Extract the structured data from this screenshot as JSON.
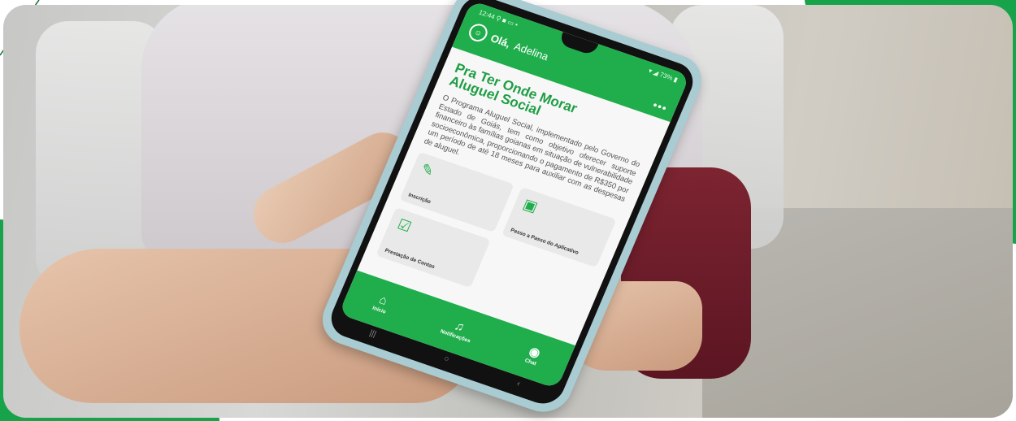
{
  "phone": {
    "status_left": "12:44 ⚲ ■ ▭ •",
    "status_right": "▾ ◢ 73% ▮",
    "greeting_bold": "Olá,",
    "greeting_name": "Adelina",
    "menu": "•••",
    "title_line1": "Pra Ter Onde Morar",
    "title_line2": "Aluguel Social",
    "description": "O Programa Aluguel Social, implementado pelo Governo do Estado de Goiás, tem como objetivo oferecer suporte financeiro às famílias goianas em situação de vulnerabilidade socioeconômica, proporcionando o pagamento de R$350 por um período de até 18 meses para auxiliar com as despesas de aluguel.",
    "cards": [
      {
        "label": "Inscrição",
        "icon": "edit-icon"
      },
      {
        "label": "Passo a Passo do Aplicativo",
        "icon": "phone-guide-icon"
      },
      {
        "label": "Prestação de Contas",
        "icon": "document-check-icon"
      }
    ],
    "nav": [
      {
        "label": "Início",
        "icon": "home-icon"
      },
      {
        "label": "Notificações",
        "icon": "bell-icon"
      },
      {
        "label": "Chat",
        "icon": "chat-icon"
      }
    ],
    "system_nav": [
      "|||",
      "○",
      "‹"
    ]
  },
  "colors": {
    "brand_green": "#1fae4b",
    "frame_green": "#17a34a",
    "phone_case": "#a9cbd2"
  }
}
